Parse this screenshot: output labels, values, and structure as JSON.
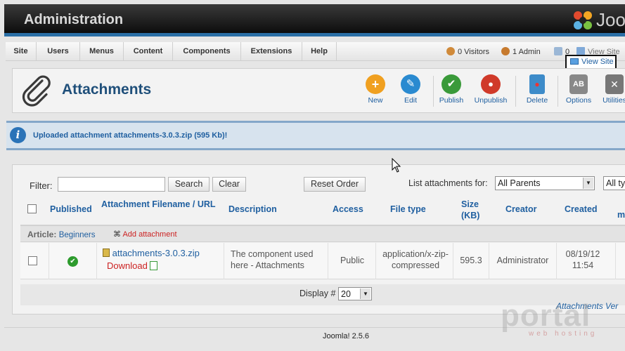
{
  "header": {
    "title": "Administration",
    "logo_text": "Joo"
  },
  "menubar": {
    "items": [
      "Site",
      "Users",
      "Menus",
      "Content",
      "Components",
      "Extensions",
      "Help"
    ],
    "visitors": "0 Visitors",
    "admins": "1 Admin",
    "messages": "0",
    "view_site": "View Site"
  },
  "view_site_button": "View Site",
  "toolbar": {
    "title": "Attachments",
    "buttons": {
      "new": "New",
      "edit": "Edit",
      "publish": "Publish",
      "unpublish": "Unpublish",
      "delete": "Delete",
      "options": "Options",
      "utilities": "Utilities"
    }
  },
  "message": {
    "text": "Uploaded attachment attachments-3.0.3.zip (595 Kb)!"
  },
  "filters": {
    "filter_label": "Filter:",
    "filter_value": "",
    "search": "Search",
    "clear": "Clear",
    "reset_order": "Reset Order",
    "list_label": "List attachments for:",
    "parent_select": "All Parents",
    "type_select": "All ty"
  },
  "table": {
    "headers": {
      "published": "Published",
      "filename": "Attachment Filename / URL",
      "description": "Description",
      "access": "Access",
      "file_type": "File type",
      "size": "Size (KB)",
      "creator": "Creator",
      "created": "Created",
      "modified": "m"
    },
    "group": {
      "label": "Article:",
      "link": "Beginners",
      "add": "Add attachment"
    },
    "row": {
      "filename": "attachments-3.0.3.zip",
      "download": "Download",
      "description": "The component used here - Attachments",
      "access": "Public",
      "file_type": "application/x-zip-compressed",
      "size": "595.3",
      "creator": "Administrator",
      "created": "08/19/12 11:54"
    }
  },
  "pagination": {
    "label": "Display #",
    "value": "20"
  },
  "version_link": "Attachments Ver",
  "footer": {
    "text": "Joomla! 2.5.6"
  },
  "watermark": {
    "text": "portal",
    "sub": "web hosting"
  },
  "colors": {
    "accent": "#1f5fa0",
    "header_bar": "#2b6fa6",
    "danger": "#cc2222"
  }
}
